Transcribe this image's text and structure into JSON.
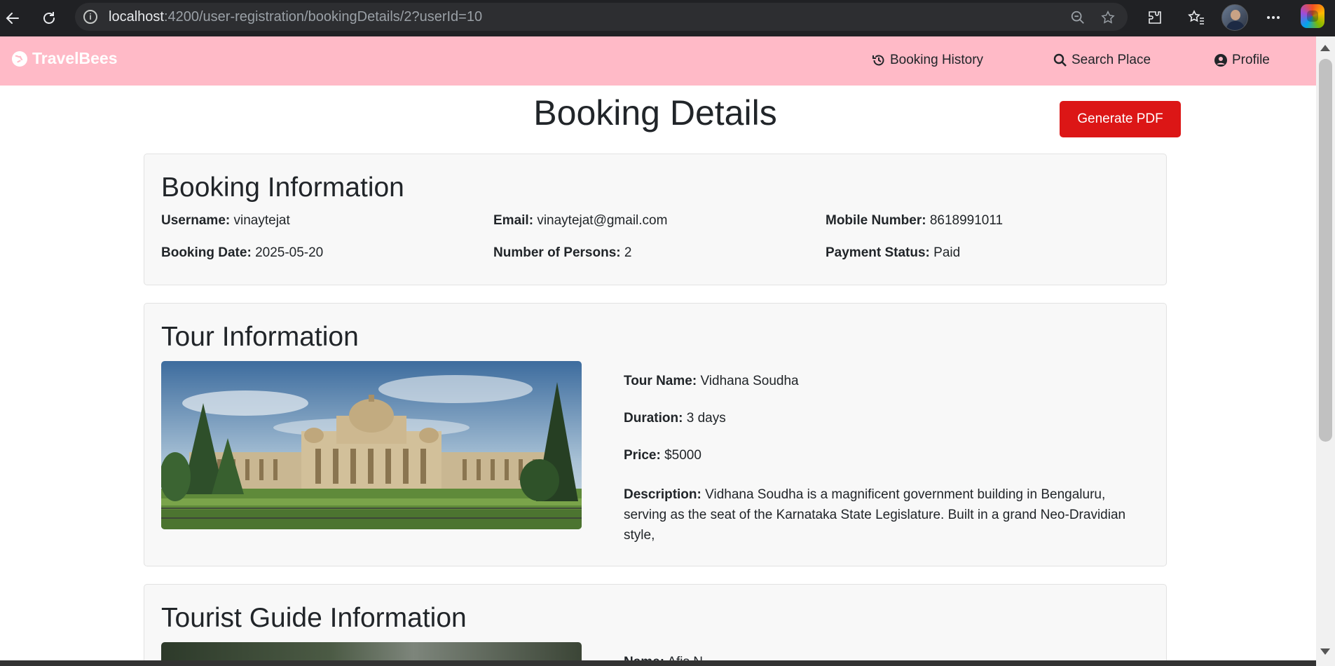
{
  "browser": {
    "url_host": "localhost",
    "url_path": ":4200/user-registration/bookingDetails/2?userId=10"
  },
  "navbar": {
    "brand": "TravelBees",
    "links": [
      {
        "label": "Booking History",
        "icon": "history-icon"
      },
      {
        "label": "Search Place",
        "icon": "search-icon"
      },
      {
        "label": "Profile",
        "icon": "user-circle-icon"
      }
    ],
    "background": "#ffbac7"
  },
  "page": {
    "title": "Booking Details",
    "generate_pdf_label": "Generate PDF",
    "accent": "#dc1616"
  },
  "booking": {
    "heading": "Booking Information",
    "fields": [
      {
        "label": "Username:",
        "value": "vinaytejat"
      },
      {
        "label": "Email:",
        "value": "vinaytejat@gmail.com"
      },
      {
        "label": "Mobile Number:",
        "value": "8618991011"
      },
      {
        "label": "Booking Date:",
        "value": "2025-05-20"
      },
      {
        "label": "Number of Persons:",
        "value": "2"
      },
      {
        "label": "Payment Status:",
        "value": "Paid"
      }
    ]
  },
  "tour": {
    "heading": "Tour Information",
    "fields": [
      {
        "label": "Tour Name:",
        "value": "Vidhana Soudha"
      },
      {
        "label": "Duration:",
        "value": "3 days"
      },
      {
        "label": "Price:",
        "value": "$5000"
      }
    ],
    "description_label": "Description:",
    "description": "Vidhana Soudha is a magnificent government building in Bengaluru, serving as the seat of the Karnataka State Legislature. Built in a grand Neo-Dravidian style,"
  },
  "guide": {
    "heading": "Tourist Guide Information",
    "name_label": "Name:",
    "name_value": "Afis N"
  }
}
